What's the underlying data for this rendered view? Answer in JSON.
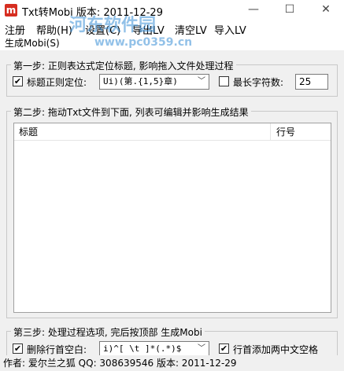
{
  "window": {
    "app_icon_letter": "m",
    "title": "Txt转Mobi  版本: 2011-12-29",
    "minimize_glyph": "—",
    "maximize_glyph": "☐",
    "close_glyph": "✕"
  },
  "menu": {
    "row1": [
      "注册",
      "帮助(H)",
      "设置(C)",
      "导出LV",
      "清空LV",
      "导入LV"
    ],
    "row2": [
      "生成Mobi(S)"
    ]
  },
  "watermark": {
    "logo_text": "河东软件园",
    "url": "www.pc0359.cn"
  },
  "step1": {
    "title": "第一步: 正则表达式定位标题, 影响拖入文件处理过程",
    "checkbox_checked": true,
    "checkbox_label": "标题正则定位:",
    "regex_value": "Ui)(第.{1,5}章)",
    "maxlen_checked": false,
    "maxlen_label": "最长字符数:",
    "maxlen_value": "25"
  },
  "step2": {
    "title": "第二步: 拖动Txt文件到下面, 列表可编辑并影响生成结果",
    "columns": [
      "标题",
      "行号"
    ],
    "rows": []
  },
  "step3": {
    "title": "第三步: 处理过程选项, 完后按顶部 生成Mobi",
    "delete_checked": true,
    "delete_label": "删除行首空白:",
    "delete_regex": "i)^[ \\t  ]*(.*)$",
    "add_checked": true,
    "add_label": "行首添加两中文空格"
  },
  "status": {
    "text": "作者: 爱尔兰之狐   QQ: 308639546   版本: 2011-12-29"
  },
  "colors": {
    "app_icon": "#d62d20",
    "client_bg": "#f0f0f0",
    "watermark": "#3a8fd6"
  }
}
